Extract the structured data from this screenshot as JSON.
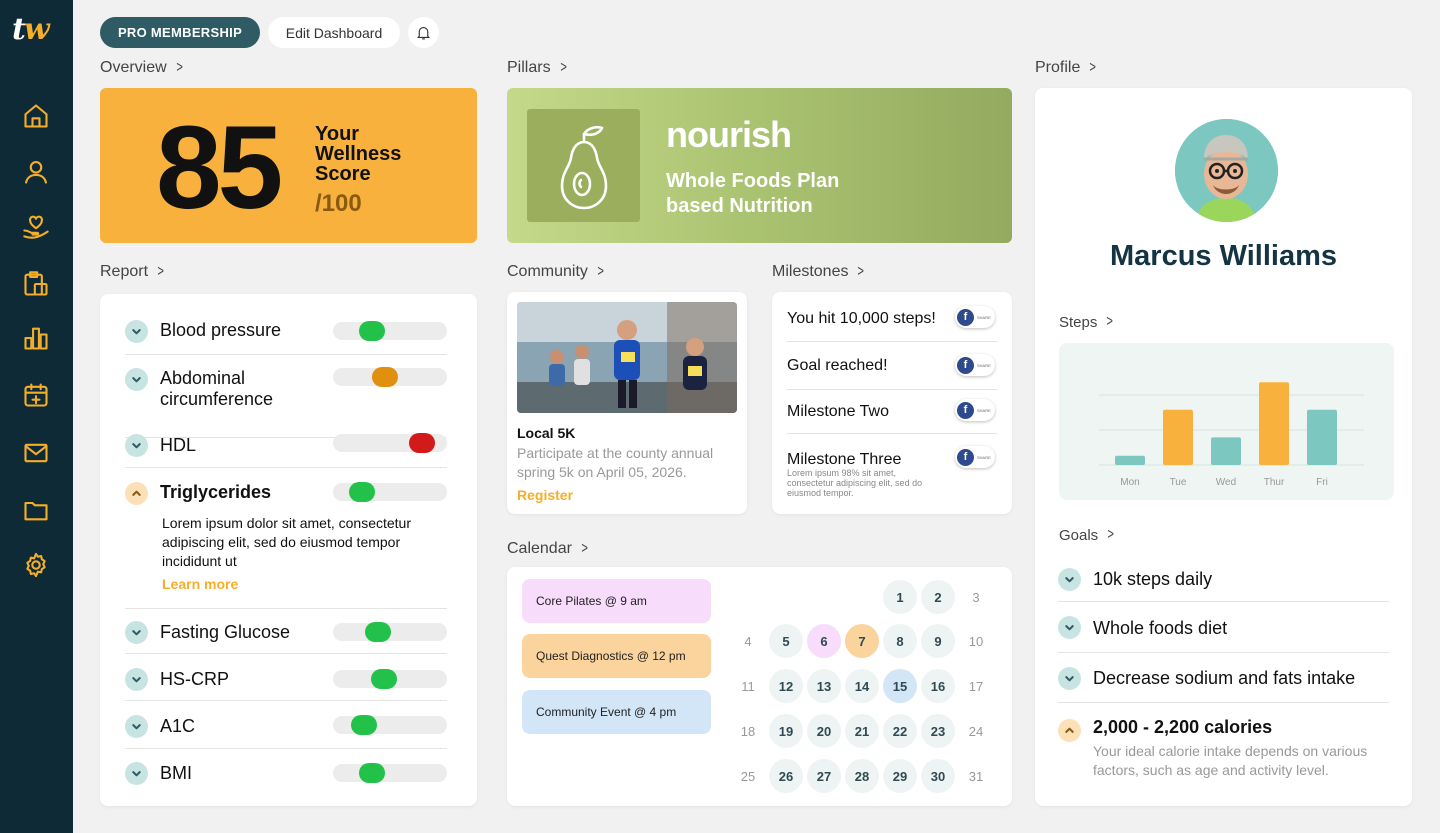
{
  "brand": {
    "logo_t": "t",
    "logo_w": "w",
    "accent": "#f5ae2a",
    "dark": "#0e2a37"
  },
  "sidebar": {
    "items": [
      {
        "icon": "home-icon"
      },
      {
        "icon": "user-icon"
      },
      {
        "icon": "hand-heart-icon"
      },
      {
        "icon": "clipboard-icon"
      },
      {
        "icon": "bar-chart-icon"
      },
      {
        "icon": "calendar-plus-icon"
      },
      {
        "icon": "mail-icon"
      },
      {
        "icon": "folder-icon"
      },
      {
        "icon": "gear-icon"
      }
    ]
  },
  "topbar": {
    "pro_label": "PRO MEMBERSHIP",
    "edit_label": "Edit Dashboard"
  },
  "overview": {
    "title": "Overview",
    "score": "85",
    "label_line1": "Your",
    "label_line2": "Wellness",
    "label_line3": "Score",
    "max": "/100"
  },
  "pillars": {
    "title": "Pillars",
    "name": "nourish",
    "sub_line1": "Whole Foods Plan",
    "sub_line2": "based Nutrition"
  },
  "report": {
    "title": "Report",
    "items": [
      {
        "label": "Blood pressure",
        "level": 0.29,
        "color": "#22c24a"
      },
      {
        "label": "Abdominal circumference",
        "level": 0.44,
        "color": "#e0900f"
      },
      {
        "label": "HDL",
        "level": 0.86,
        "color": "#d21a1a"
      },
      {
        "label": "Triglycerides",
        "level": 0.18,
        "color": "#22c24a",
        "expanded": true,
        "desc": "Lorem ipsum dolor sit amet, consectetur adipiscing elit, sed do eiusmod tempor incididunt ut",
        "link": "Learn more"
      },
      {
        "label": "Fasting Glucose",
        "level": 0.36,
        "color": "#22c24a"
      },
      {
        "label": "HS-CRP",
        "level": 0.43,
        "color": "#22c24a"
      },
      {
        "label": "A1C",
        "level": 0.2,
        "color": "#22c24a"
      },
      {
        "label": "BMI",
        "level": 0.29,
        "color": "#22c24a"
      }
    ]
  },
  "community": {
    "title": "Community",
    "event_title": "Local 5K",
    "event_desc": "Participate at the county annual spring 5k on April 05, 2026.",
    "cta": "Register"
  },
  "milestones": {
    "title": "Milestones",
    "share_label": "SHARE",
    "items": [
      {
        "label": "You hit 10,000 steps!"
      },
      {
        "label": "Goal reached!"
      },
      {
        "label": "Milestone Two"
      },
      {
        "label": "Milestone Three",
        "small": "Lorem ipsum 98% sit amet, consectetur adipiscing elit, sed do eiusmod tempor."
      }
    ]
  },
  "calendar": {
    "title": "Calendar",
    "events": [
      {
        "label": "Core Pilates @ 9 am",
        "color": "#f7dcfb"
      },
      {
        "label": "Quest Diagnostics @ 12 pm",
        "color": "#fbd39d"
      },
      {
        "label": "Community Event @ 4 pm",
        "color": "#d3e6f7"
      }
    ],
    "weeks": [
      [
        "",
        "",
        "",
        "",
        "1",
        "2",
        "3"
      ],
      [
        "4",
        "5",
        "6",
        "7",
        "8",
        "9",
        "10"
      ],
      [
        "11",
        "12",
        "13",
        "14",
        "15",
        "16",
        "17"
      ],
      [
        "18",
        "19",
        "20",
        "21",
        "22",
        "23",
        "24"
      ],
      [
        "25",
        "26",
        "27",
        "28",
        "29",
        "30",
        "31"
      ]
    ]
  },
  "profile": {
    "title": "Profile",
    "name": "Marcus Williams",
    "steps_title": "Steps",
    "goals_title": "Goals",
    "goals": [
      {
        "label": "10k steps daily"
      },
      {
        "label": "Whole foods diet"
      },
      {
        "label": "Decrease sodium and fats intake"
      },
      {
        "label": "2,000 - 2,200 calories",
        "expanded": true,
        "desc": "Your ideal calorie intake depends on various factors, such as age and activity level."
      }
    ]
  },
  "chart_data": {
    "type": "bar",
    "categories": [
      "Mon",
      "Tue",
      "Wed",
      "Thur",
      "Fri"
    ],
    "values": [
      1,
      6,
      3,
      9,
      6
    ],
    "ylim": [
      0,
      10
    ],
    "colors": [
      "#7cc7c0",
      "#f8b13c",
      "#7cc7c0",
      "#f8b13c",
      "#7cc7c0"
    ],
    "grid": true
  }
}
